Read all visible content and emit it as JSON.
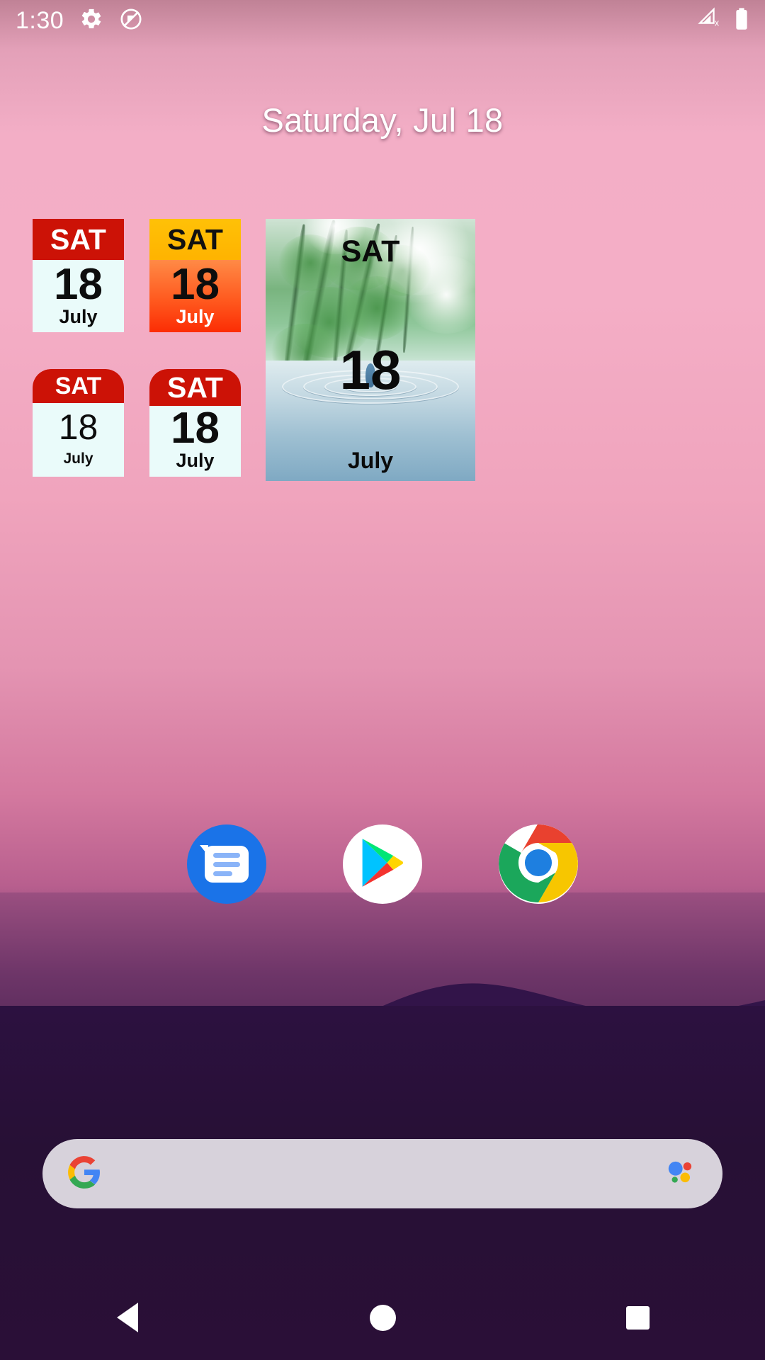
{
  "status_bar": {
    "clock": "1:30",
    "icons_left": [
      "gear-icon",
      "data-saver-off-icon"
    ],
    "icons_right": [
      "signal-no-service-icon",
      "battery-full-icon"
    ]
  },
  "home": {
    "date_header": "Saturday, Jul 18"
  },
  "widgets": [
    {
      "id": "calendar-widget-red-square",
      "weekday": "SAT",
      "day": "18",
      "month": "July",
      "header_color": "#cc1206",
      "body_color": "#eafbfa"
    },
    {
      "id": "calendar-widget-amber-square",
      "weekday": "SAT",
      "day": "18",
      "month": "July",
      "header_color": "#ffb300",
      "body_color": "#ff5a1f"
    },
    {
      "id": "calendar-widget-red-rounded-thin",
      "weekday": "SAT",
      "day": "18",
      "month": "July",
      "header_color": "#cc1206",
      "body_color": "#eafbfa"
    },
    {
      "id": "calendar-widget-red-rounded-bold",
      "weekday": "SAT",
      "day": "18",
      "month": "July",
      "header_color": "#cc1206",
      "body_color": "#eafbfa"
    },
    {
      "id": "calendar-widget-photo-forest",
      "weekday": "SAT",
      "day": "18",
      "month": "July",
      "background": "forest-water-droplet-photo"
    }
  ],
  "dock": {
    "items": [
      {
        "name": "messages",
        "label": "Messages",
        "icon": "messages-icon"
      },
      {
        "name": "play-store",
        "label": "Play Store",
        "icon": "play-store-icon"
      },
      {
        "name": "chrome",
        "label": "Chrome",
        "icon": "chrome-icon"
      }
    ]
  },
  "search": {
    "value": "",
    "placeholder": "",
    "left_icon": "google-g-icon",
    "right_icon": "google-assistant-icon"
  },
  "nav_bar": {
    "back": "back-button",
    "home": "home-button",
    "recents": "recents-button"
  }
}
